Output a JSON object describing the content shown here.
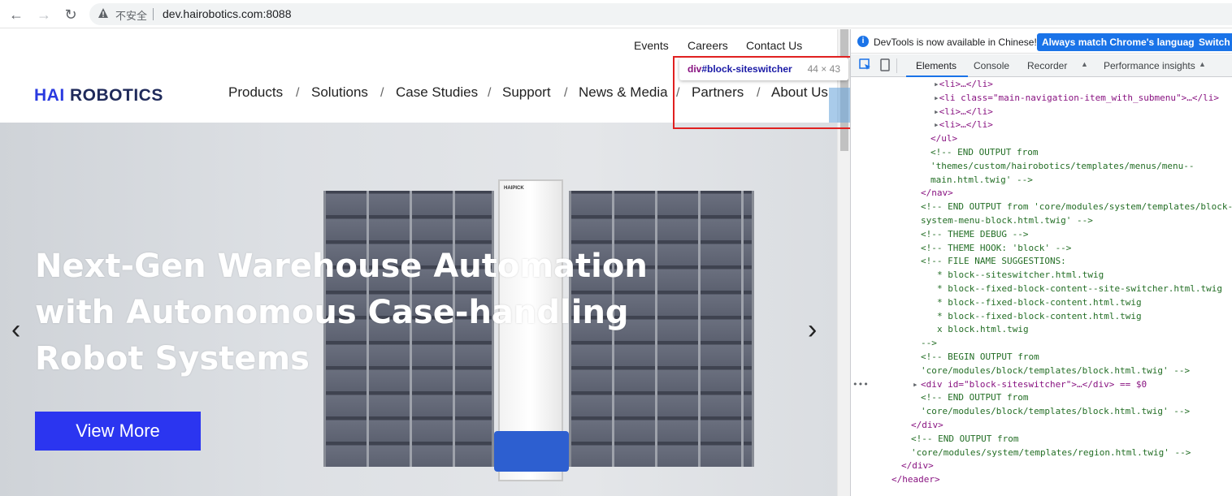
{
  "browser": {
    "security_label": "不安全",
    "url": "dev.hairobotics.com:8088"
  },
  "site": {
    "top_links": [
      "Events",
      "Careers",
      "Contact Us"
    ],
    "logo_hai": "HAI",
    "logo_rest": "ROBOTICS",
    "main_nav": [
      "Products",
      "Solutions",
      "Case Studies",
      "Support",
      "News & Media",
      "Partners",
      "About Us"
    ],
    "nav_separator": "/",
    "hero": {
      "title_line1": "Next-Gen Warehouse Automation",
      "title_line2": "with Autonomous Case-handling",
      "title_line3": "Robot Systems",
      "button": "View More",
      "robot_label": "HAIPICK",
      "prev_arrow": "‹",
      "next_arrow": "›"
    }
  },
  "inspect_tooltip": {
    "tag": "div",
    "selector": "#block-siteswitcher",
    "size": "44 × 43"
  },
  "devtools": {
    "banner_text": "DevTools is now available in Chinese!",
    "btn_match": "Always match Chrome's language",
    "btn_switch": "Switch D",
    "tabs": [
      "Elements",
      "Console",
      "Recorder",
      "Performance insights"
    ],
    "active_tab": "Elements",
    "lines": [
      "<li>…</li>",
      "<li class=\"main-navigation-item_with_submenu\">…</li>",
      "<li>…</li>",
      "<li>…</li>",
      "</ul>",
      "<!-- END OUTPUT from",
      "'themes/custom/hairobotics/templates/menus/menu--",
      "main.html.twig' -->",
      "</nav>",
      "<!-- END OUTPUT from 'core/modules/system/templates/block-",
      "system-menu-block.html.twig' -->",
      "<!-- THEME DEBUG -->",
      "<!-- THEME HOOK: 'block' -->",
      "<!-- FILE NAME SUGGESTIONS:",
      "* block--siteswitcher.html.twig",
      "* block--fixed-block-content--site-switcher.html.twig",
      "* block--fixed-block-content.html.twig",
      "* block--fixed-block-content.html.twig",
      "x block.html.twig",
      "-->",
      "<!-- BEGIN OUTPUT from",
      "'core/modules/block/templates/block.html.twig' -->",
      "<div id=\"block-siteswitcher\">…</div> == $0",
      "<!-- END OUTPUT from",
      "'core/modules/block/templates/block.html.twig' -->",
      "</div>",
      "<!-- END OUTPUT from",
      "'core/modules/system/templates/region.html.twig' -->",
      "</div>",
      "</header>"
    ],
    "selected_dots": "•••"
  }
}
